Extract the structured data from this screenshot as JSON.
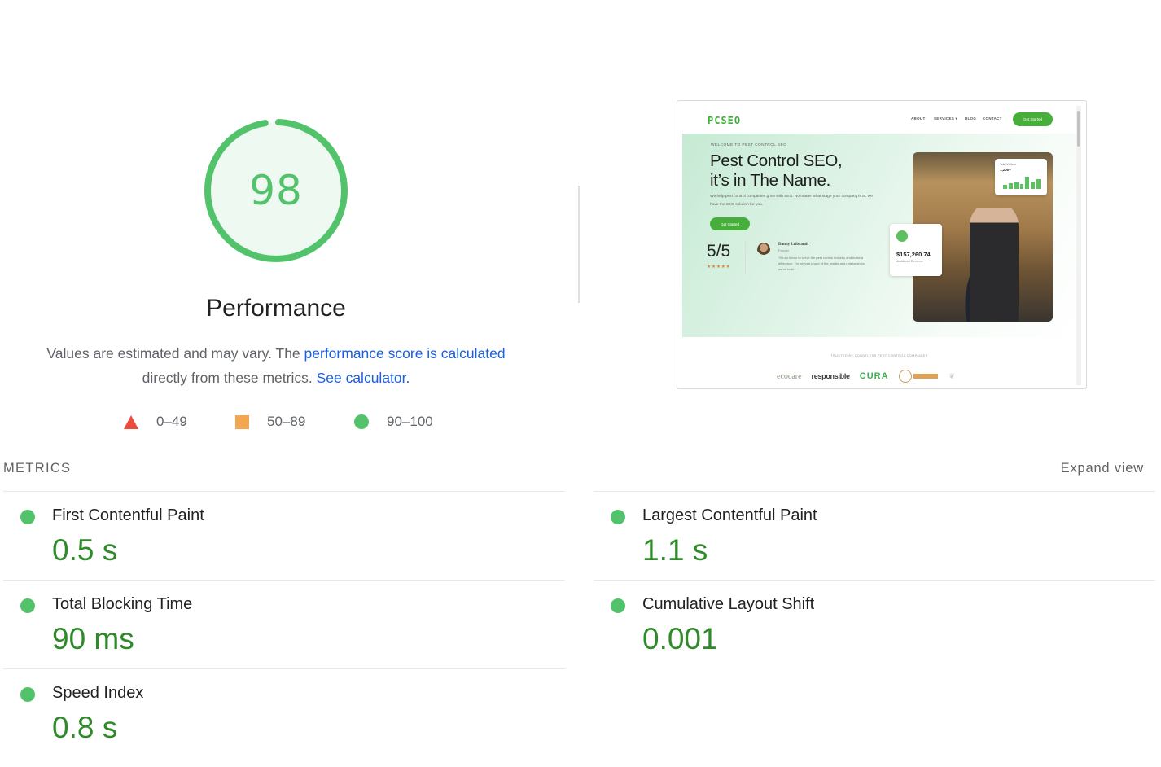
{
  "gauge": {
    "score": "98",
    "score_value": 98,
    "title": "Performance",
    "color": "#52c36b",
    "fill_color": "#edf9f1"
  },
  "description": {
    "text_before": "Values are estimated and may vary. The ",
    "link1": "performance score is calculated",
    "text_middle": " directly from these metrics. ",
    "link2": "See calculator."
  },
  "legend": [
    {
      "shape": "triangle-icon",
      "range": "0–49",
      "color": "#eb4d3d"
    },
    {
      "shape": "square-icon",
      "range": "50–89",
      "color": "#f2a650"
    },
    {
      "shape": "circle-icon",
      "range": "90–100",
      "color": "#52c36b"
    }
  ],
  "screenshot": {
    "logo": "PCSEO",
    "nav": [
      "ABOUT",
      "SERVICES ▾",
      "BLOG",
      "CONTACT"
    ],
    "nav_cta": "Get Started",
    "eyebrow": "WELCOME TO PEST CONTROL SEO",
    "headline_line1": "Pest Control SEO,",
    "headline_line2": "it’s in The Name.",
    "subtext": "We help pest control companies grow with SEO. No matter what stage your company is at, we have the SEO solution for you.",
    "hero_button": "Get Started",
    "rating": "5/5",
    "stars": "★★★★★",
    "reviewer_name": "Danny Leibrandt",
    "reviewer_role": "Founder",
    "quote": "“It's an honor to serve the pest control industry and make a difference. I'm beyond proud of the results and relationships we've built.”",
    "chart_card_label": "Total Visitors",
    "chart_card_value": "1,200+",
    "revenue_amount": "$157,260.74",
    "revenue_caption": "Additional Revenue",
    "trusted_text": "TRUSTED BY COUNTLESS PEST CONTROL COMPANIES",
    "partner_logos": [
      "ecocare",
      "responsible",
      "CURA",
      "badge-logo",
      "leaf-logo"
    ]
  },
  "metrics": {
    "header": "METRICS",
    "expand_label": "Expand view",
    "items": [
      {
        "name": "First Contentful Paint",
        "value": "0.5 s",
        "status": "good"
      },
      {
        "name": "Largest Contentful Paint",
        "value": "1.1 s",
        "status": "good"
      },
      {
        "name": "Total Blocking Time",
        "value": "90 ms",
        "status": "good"
      },
      {
        "name": "Cumulative Layout Shift",
        "value": "0.001",
        "status": "good"
      },
      {
        "name": "Speed Index",
        "value": "0.8 s",
        "status": "good"
      }
    ]
  }
}
